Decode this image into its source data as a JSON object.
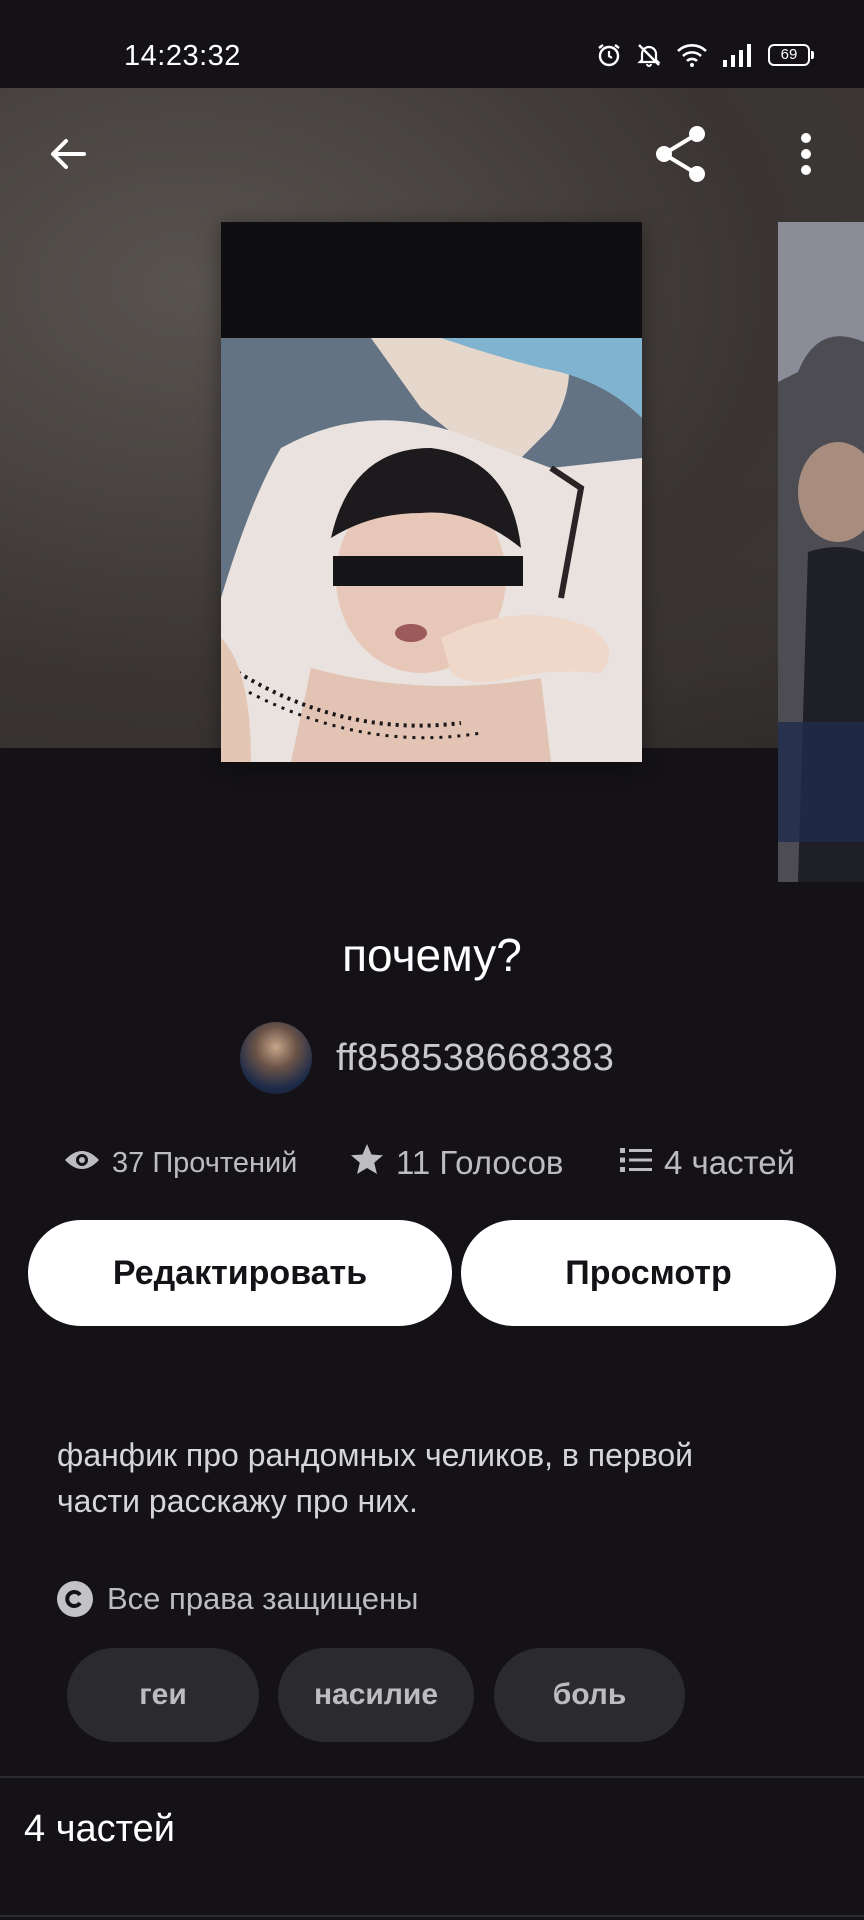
{
  "status_bar": {
    "time": "14:23:32",
    "battery": "69",
    "icons": [
      "alarm-icon",
      "bell-off-icon",
      "wifi-icon",
      "signal-icon",
      "battery-icon"
    ]
  },
  "toolbar": {
    "icons": [
      "back-arrow-icon",
      "share-icon",
      "more-vertical-icon"
    ]
  },
  "story": {
    "title": "почему?",
    "author": "ff858538668383",
    "stats": {
      "reads": "37 Прочтений",
      "votes": "11 Голосов",
      "parts": "4 частей"
    },
    "description": "фанфик про рандомных челиков, в первой части расскажу про них.",
    "rights": "Все права защищены",
    "tags": [
      "геи",
      "насилие",
      "боль"
    ]
  },
  "actions": {
    "edit_label": "Редактировать",
    "view_label": "Просмотр"
  },
  "parts_section": {
    "heading": "4 частей"
  },
  "colors": {
    "background": "#141216",
    "button_bg": "#ffffff",
    "tag_bg": "#2b2a2e",
    "muted_text": "#bdbcc1"
  }
}
